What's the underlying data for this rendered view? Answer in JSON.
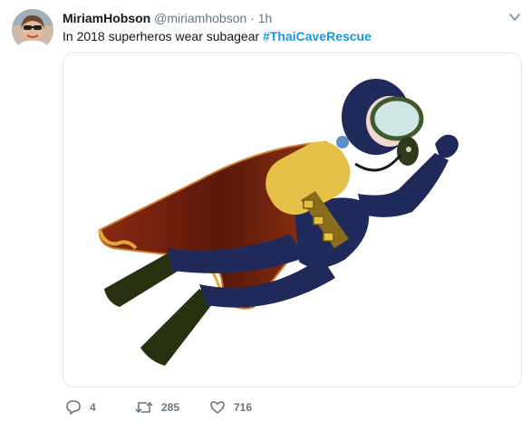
{
  "tweet": {
    "display_name": "MiriamHobson",
    "handle": "@miriamhobson",
    "separator": "·",
    "time": "1h",
    "text": "In 2018 superheros wear subagear",
    "hashtag": "#ThaiCaveRescue"
  },
  "actions": {
    "reply_count": "4",
    "retweet_count": "285",
    "like_count": "716"
  },
  "colors": {
    "link": "#1b95e0",
    "muted": "#657786",
    "border": "#e1e8ed"
  },
  "icons": {
    "reply": "reply-icon",
    "retweet": "retweet-icon",
    "like": "heart-icon",
    "more": "chevron-down-icon"
  }
}
